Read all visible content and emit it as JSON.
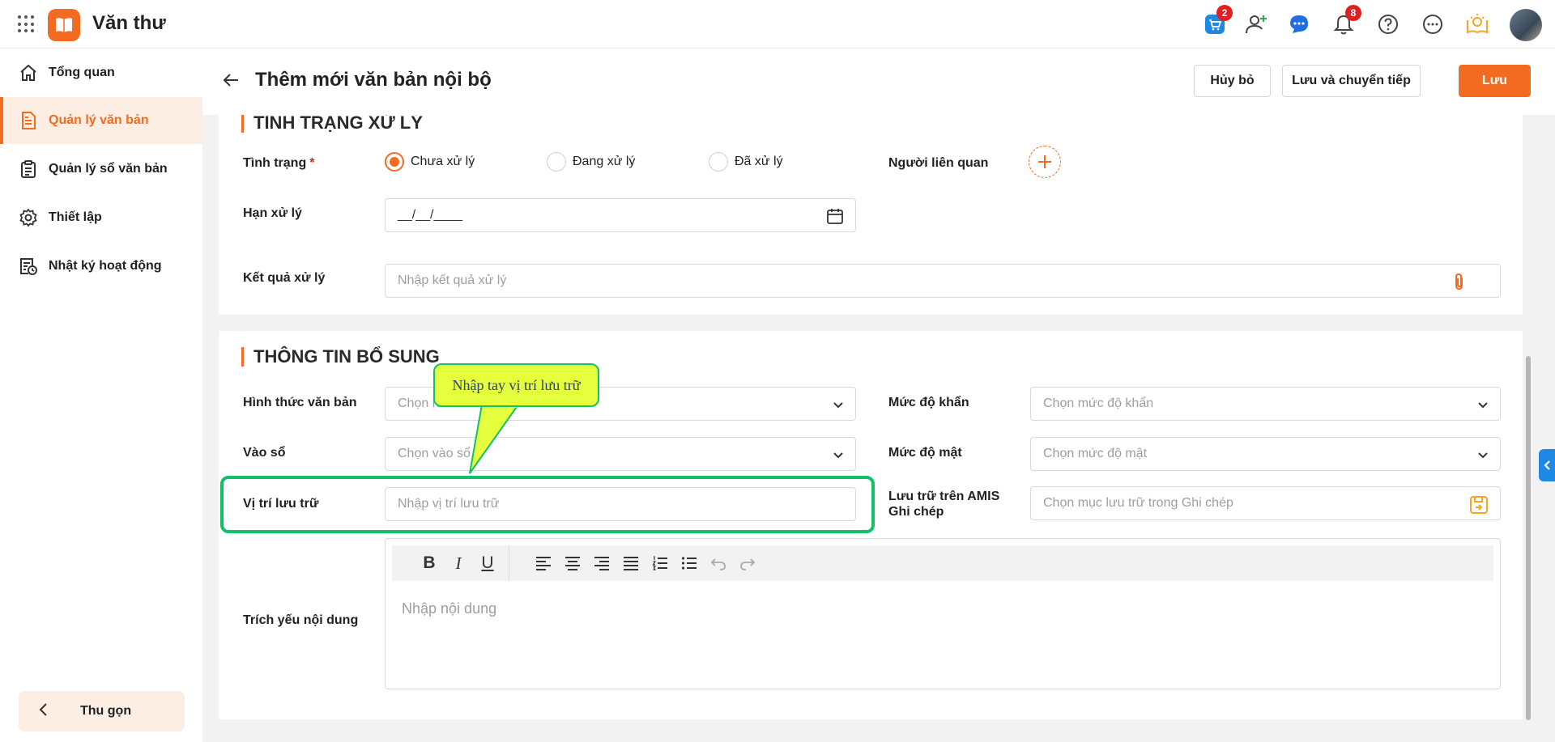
{
  "app": {
    "title": "Văn thư"
  },
  "topbar": {
    "cart_badge": "2",
    "notification_badge": "8"
  },
  "sidebar": {
    "items": [
      {
        "label": "Tổng quan"
      },
      {
        "label": "Quản lý văn bản"
      },
      {
        "label": "Quản lý sổ văn bản"
      },
      {
        "label": "Thiết lập"
      },
      {
        "label": "Nhật ký hoạt động"
      }
    ],
    "collapse_label": "Thu gọn"
  },
  "header": {
    "title": "Thêm mới văn bản nội bộ",
    "cancel_label": "Hủy bỏ",
    "save_continue_label": "Lưu và chuyển tiếp",
    "save_label": "Lưu"
  },
  "processing": {
    "section_title": "TÌNH TRẠNG XỬ LÝ",
    "status_label": "Tình trạng",
    "status_required": "*",
    "status_options": [
      "Chưa xử lý",
      "Đang xử lý",
      "Đã xử lý"
    ],
    "status_selected": "Chưa xử lý",
    "related_people_label": "Người liên quan",
    "deadline_label": "Hạn xử lý",
    "deadline_value": "__/__/____",
    "result_label": "Kết quả xử lý",
    "result_placeholder": "Nhập kết quả xử lý"
  },
  "extra": {
    "section_title": "THÔNG TIN BỔ SUNG",
    "doc_form_label": "Hình thức văn bản",
    "doc_form_placeholder": "Chọn h",
    "urgency_label": "Mức độ khẩn",
    "urgency_placeholder": "Chọn mức độ khẩn",
    "register_label": "Vào sổ",
    "register_placeholder": "Chọn vào sổ",
    "secrecy_label": "Mức độ mật",
    "secrecy_placeholder": "Chọn mức độ mật",
    "storage_label": "Vị trí lưu trữ",
    "storage_placeholder": "Nhập vị trí lưu trữ",
    "amis_label_line1": "Lưu trữ trên AMIS",
    "amis_label_line2": "Ghi chép",
    "amis_placeholder": "Chọn mục lưu trữ trong Ghi chép",
    "summary_label": "Trích yếu nội dung",
    "summary_placeholder": "Nhập nội dung",
    "toolbar": {
      "bold": "B",
      "italic": "I",
      "underline": "U"
    }
  },
  "annotation": {
    "callout_text": "Nhập tay vị trí lưu trữ",
    "highlight_color": "#12c06a",
    "callout_color": "#e6ff3c"
  },
  "colors": {
    "accent": "#f26b21",
    "active_bg": "#fdeee4"
  }
}
